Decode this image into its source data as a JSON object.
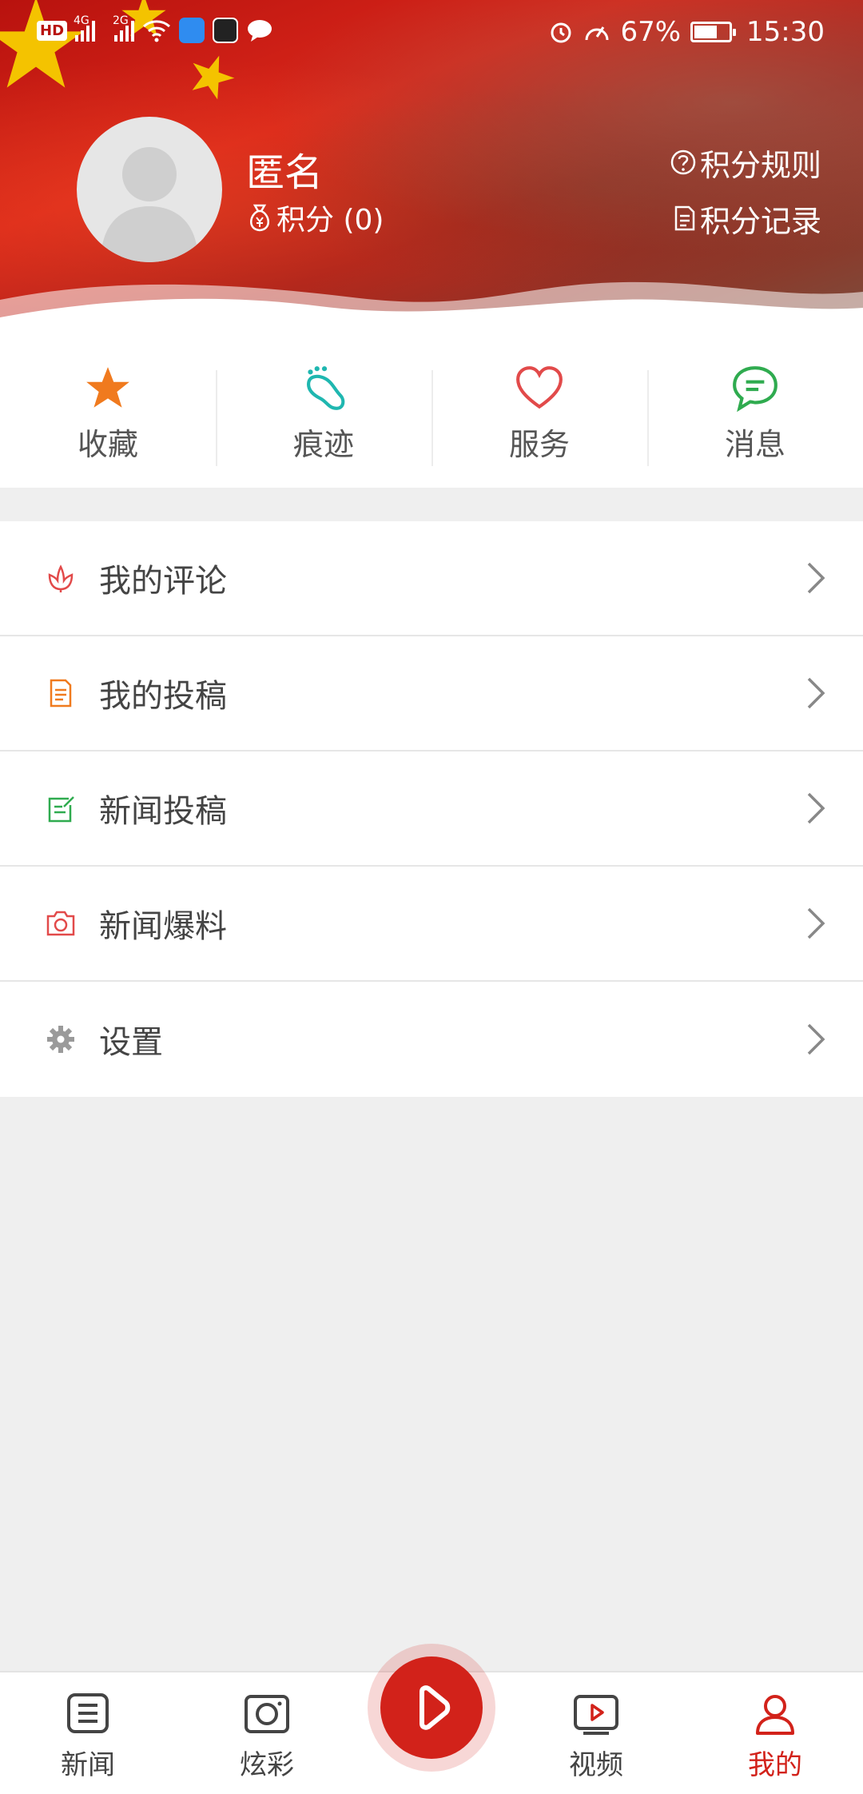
{
  "status_bar": {
    "hd": "HD",
    "net1": "4G",
    "net2": "2G",
    "battery": "67%",
    "time": "15:30"
  },
  "profile": {
    "name": "匿名",
    "points": "积分 (0)",
    "rules": "积分规则",
    "records": "积分记录"
  },
  "quick_actions": [
    {
      "label": "收藏",
      "icon": "star-icon",
      "color": "#f07a1e"
    },
    {
      "label": "痕迹",
      "icon": "footprint-icon",
      "color": "#1fb7b0"
    },
    {
      "label": "服务",
      "icon": "heart-icon",
      "color": "#e24a4a"
    },
    {
      "label": "消息",
      "icon": "message-icon",
      "color": "#2fab4f"
    }
  ],
  "menu": [
    {
      "label": "我的评论",
      "icon": "flower-icon",
      "color": "#e24a4a"
    },
    {
      "label": "我的投稿",
      "icon": "document-icon",
      "color": "#f07a1e"
    },
    {
      "label": "新闻投稿",
      "icon": "edit-icon",
      "color": "#2fab4f"
    },
    {
      "label": "新闻爆料",
      "icon": "camera-icon",
      "color": "#e24a4a"
    },
    {
      "label": "设置",
      "icon": "gear-icon",
      "color": "#9a9a9a"
    }
  ],
  "bottom_nav": [
    {
      "label": "新闻",
      "icon": "news-icon"
    },
    {
      "label": "炫彩",
      "icon": "camera-icon"
    },
    {
      "label": "视频",
      "icon": "video-icon"
    },
    {
      "label": "我的",
      "icon": "user-icon",
      "active": true
    }
  ],
  "center_button": {
    "icon": "play-icon",
    "color": "#d2221a"
  }
}
